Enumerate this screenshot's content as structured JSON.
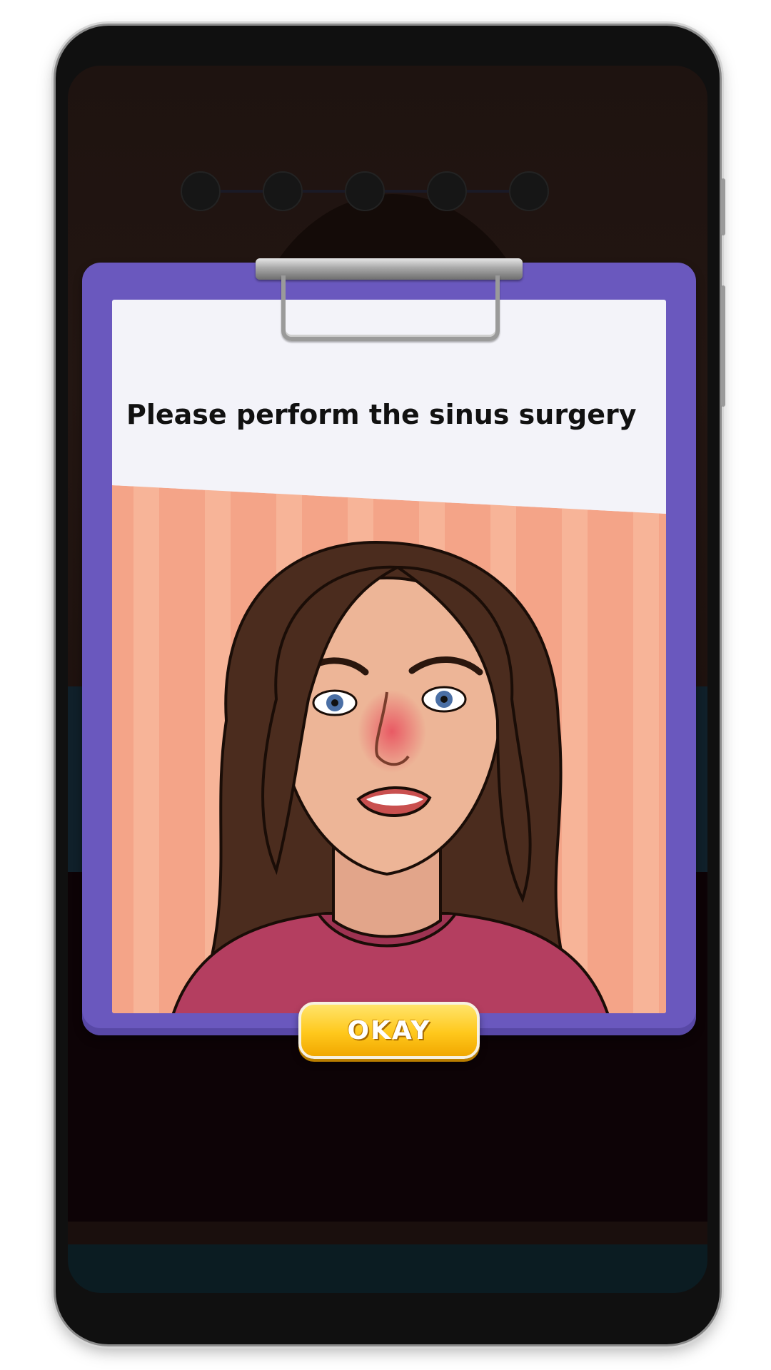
{
  "dialog": {
    "instruction": "Please perform the sinus surgery",
    "button_label": "OKAY"
  },
  "progress": {
    "steps": 5
  },
  "colors": {
    "board": "#6a58be",
    "paper": "#f3f3f9",
    "button": "#ffc81c",
    "wallpaper": "#f4a488",
    "shirt": "#b43e60"
  },
  "icons": {
    "clip": "clipboard-clip-icon"
  }
}
